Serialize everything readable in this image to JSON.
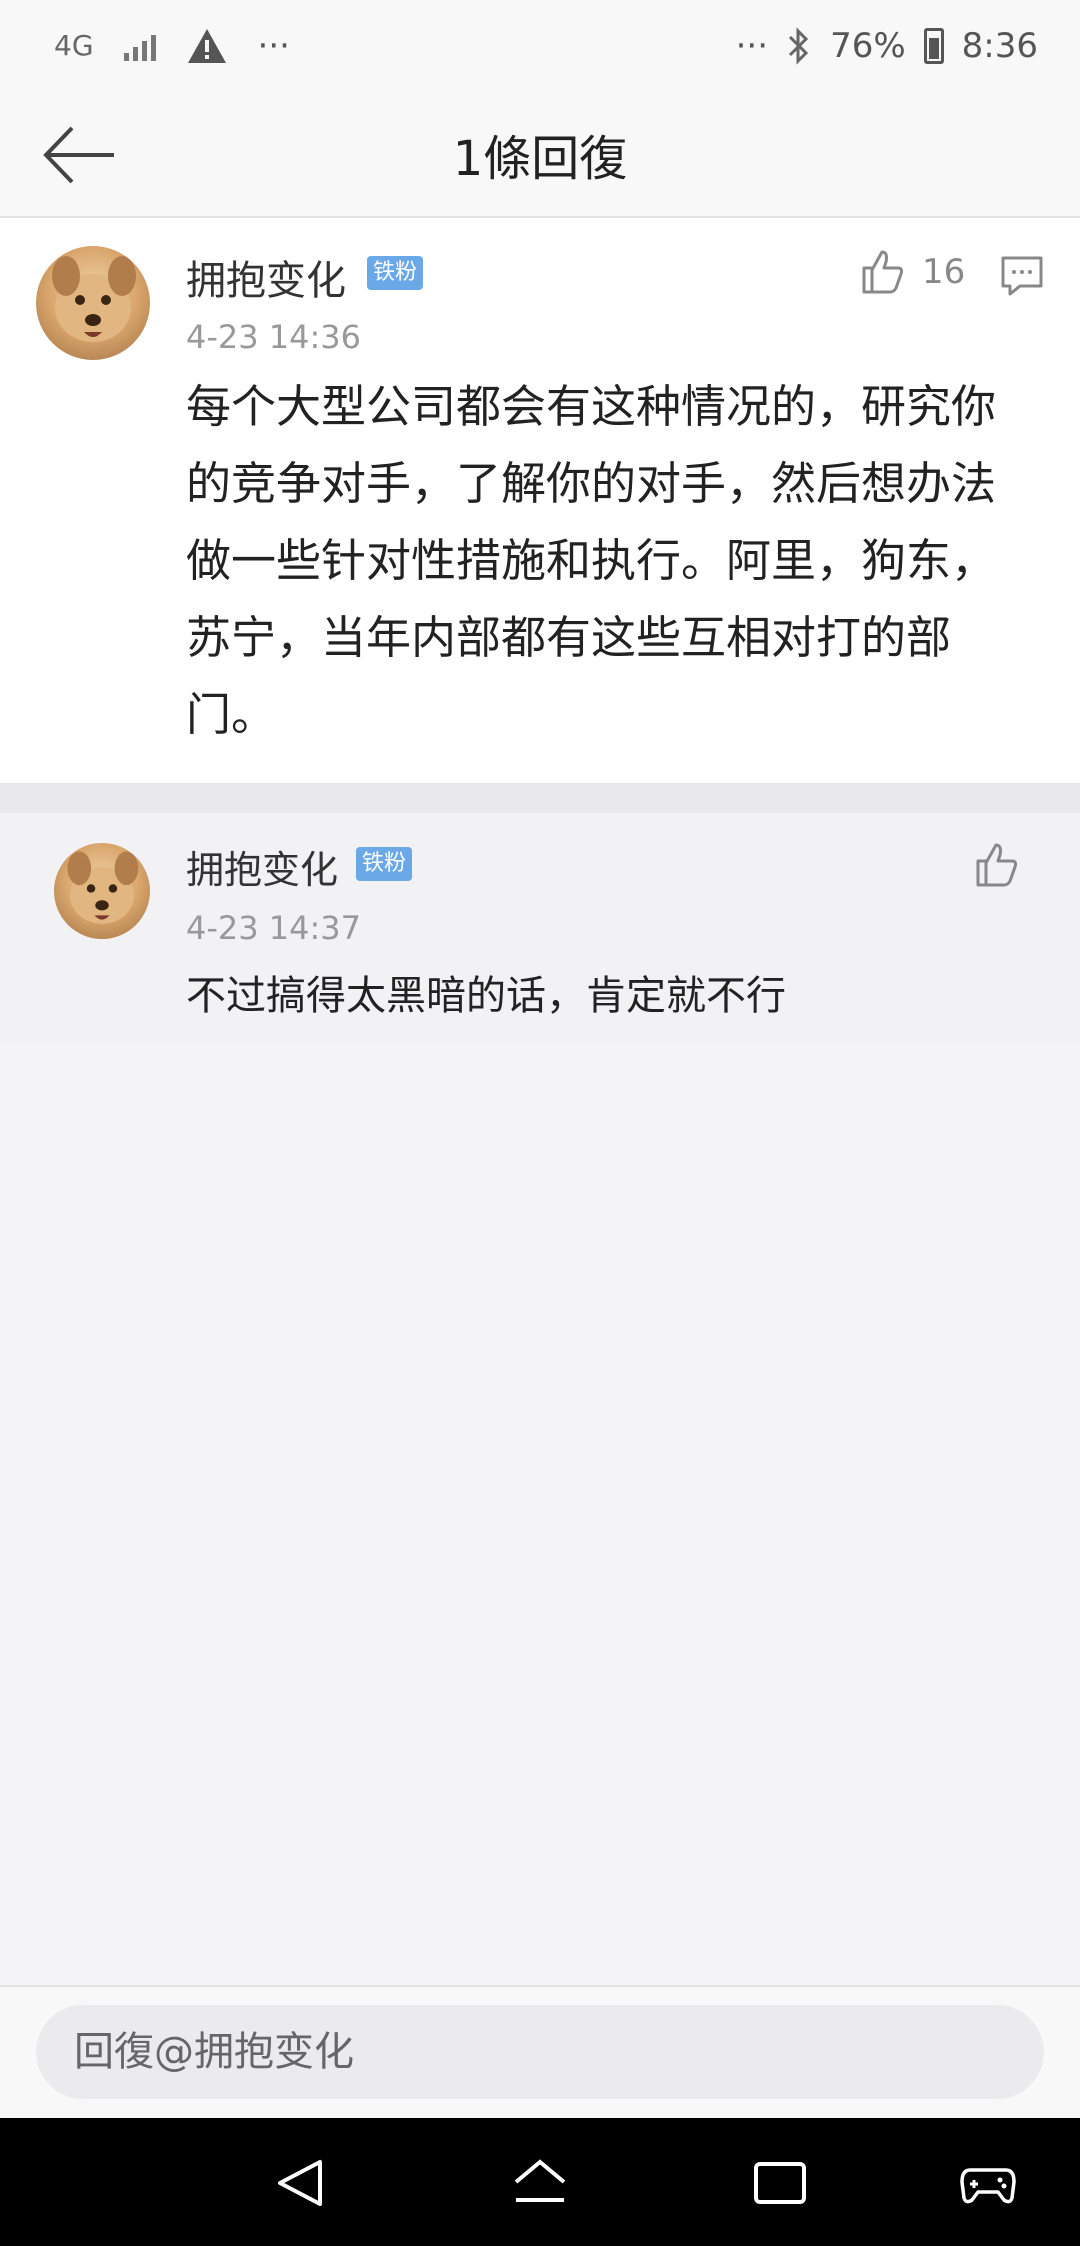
{
  "status_bar": {
    "network": "4G",
    "dots_left": "···",
    "dots_right": "···",
    "battery": "76%",
    "time": "8:36"
  },
  "header": {
    "title": "1條回復",
    "back_icon": "arrow-left-icon"
  },
  "main_comment": {
    "username": "拥抱变化",
    "badge": "铁粉",
    "timestamp": "4-23 14:36",
    "likes": "16",
    "text": "每个大型公司都会有这种情况的，研究你的竞争对手，了解你的对手，然后想办法做一些针对性措施和执行。阿里，狗东，苏宁，当年内部都有这些互相对打的部门。"
  },
  "reply": {
    "username": "拥抱变化",
    "badge": "铁粉",
    "timestamp": "4-23 14:37",
    "text": "不过搞得太黑暗的话，肯定就不行"
  },
  "input": {
    "placeholder": "回復@拥抱变化"
  },
  "colors": {
    "badge": "#6aa8e8",
    "nav_bar": "#000000",
    "divider": "#e9e9ec"
  }
}
